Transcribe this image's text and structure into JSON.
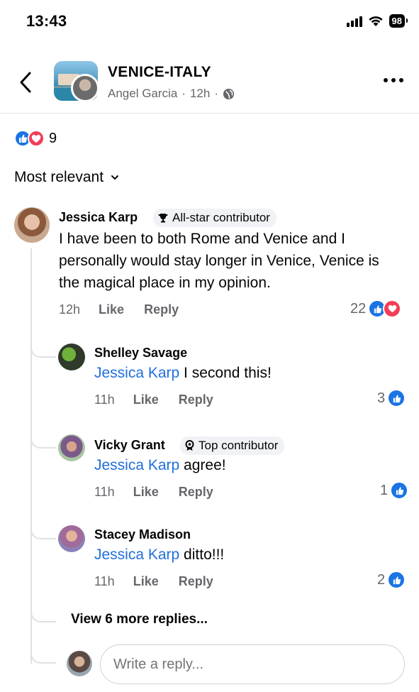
{
  "status_bar": {
    "time": "13:43",
    "battery": "98"
  },
  "header": {
    "group_name": "VENICE-ITALY",
    "author": "Angel Garcia",
    "time": "12h",
    "separator": "·"
  },
  "reactions": {
    "count": "9",
    "like_color": "#1b74e4",
    "love_color": "#f33e58"
  },
  "sort": {
    "label": "Most relevant"
  },
  "comments": [
    {
      "name": "Jessica Karp",
      "badge": "All-star contributor",
      "text": "I have been to both Rome and Venice and I personally would stay longer in Venice, Venice is the magical place in my opinion.",
      "time": "12h",
      "like": "Like",
      "reply": "Reply",
      "reaction_count": "22"
    }
  ],
  "replies": [
    {
      "name": "Shelley Savage",
      "mention": "Jessica Karp",
      "text": " I second this!",
      "time": "11h",
      "like": "Like",
      "reply": "Reply",
      "reaction_count": "3"
    },
    {
      "name": "Vicky Grant",
      "badge": "Top contributor",
      "mention": "Jessica Karp",
      "text": " agree!",
      "time": "11h",
      "like": "Like",
      "reply": "Reply",
      "reaction_count": "1"
    },
    {
      "name": "Stacey Madison",
      "mention": "Jessica Karp",
      "text": " ditto!!!",
      "time": "11h",
      "like": "Like",
      "reply": "Reply",
      "reaction_count": "2"
    }
  ],
  "view_more": "View 6 more replies...",
  "reply_input": {
    "placeholder": "Write a reply..."
  }
}
